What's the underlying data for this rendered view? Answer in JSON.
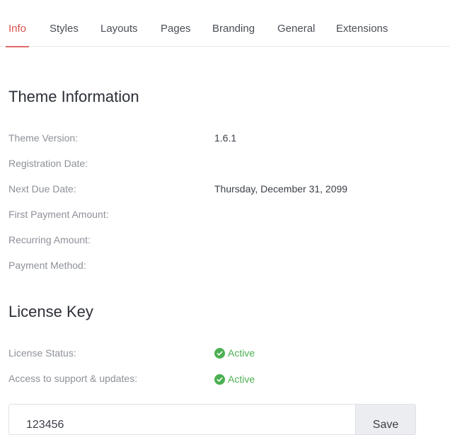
{
  "tabs": [
    {
      "label": "Info",
      "active": true
    },
    {
      "label": "Styles"
    },
    {
      "label": "Layouts"
    },
    {
      "label": "Pages"
    },
    {
      "label": "Branding"
    },
    {
      "label": "General"
    },
    {
      "label": "Extensions"
    }
  ],
  "theme_info": {
    "title": "Theme Information",
    "rows": [
      {
        "label": "Theme Version:",
        "value": "1.6.1"
      },
      {
        "label": "Registration Date:",
        "value": ""
      },
      {
        "label": "Next Due Date:",
        "value": "Thursday, December 31, 2099"
      },
      {
        "label": "First Payment Amount:",
        "value": ""
      },
      {
        "label": "Recurring Amount:",
        "value": ""
      },
      {
        "label": "Payment Method:",
        "value": ""
      }
    ]
  },
  "license": {
    "title": "License Key",
    "rows": [
      {
        "label": "License Status:",
        "status": "Active"
      },
      {
        "label": "Access to support & updates:",
        "status": "Active"
      }
    ],
    "key_value": "123456",
    "save_label": "Save"
  },
  "colors": {
    "accent": "#d9534f",
    "success": "#4caf50"
  }
}
